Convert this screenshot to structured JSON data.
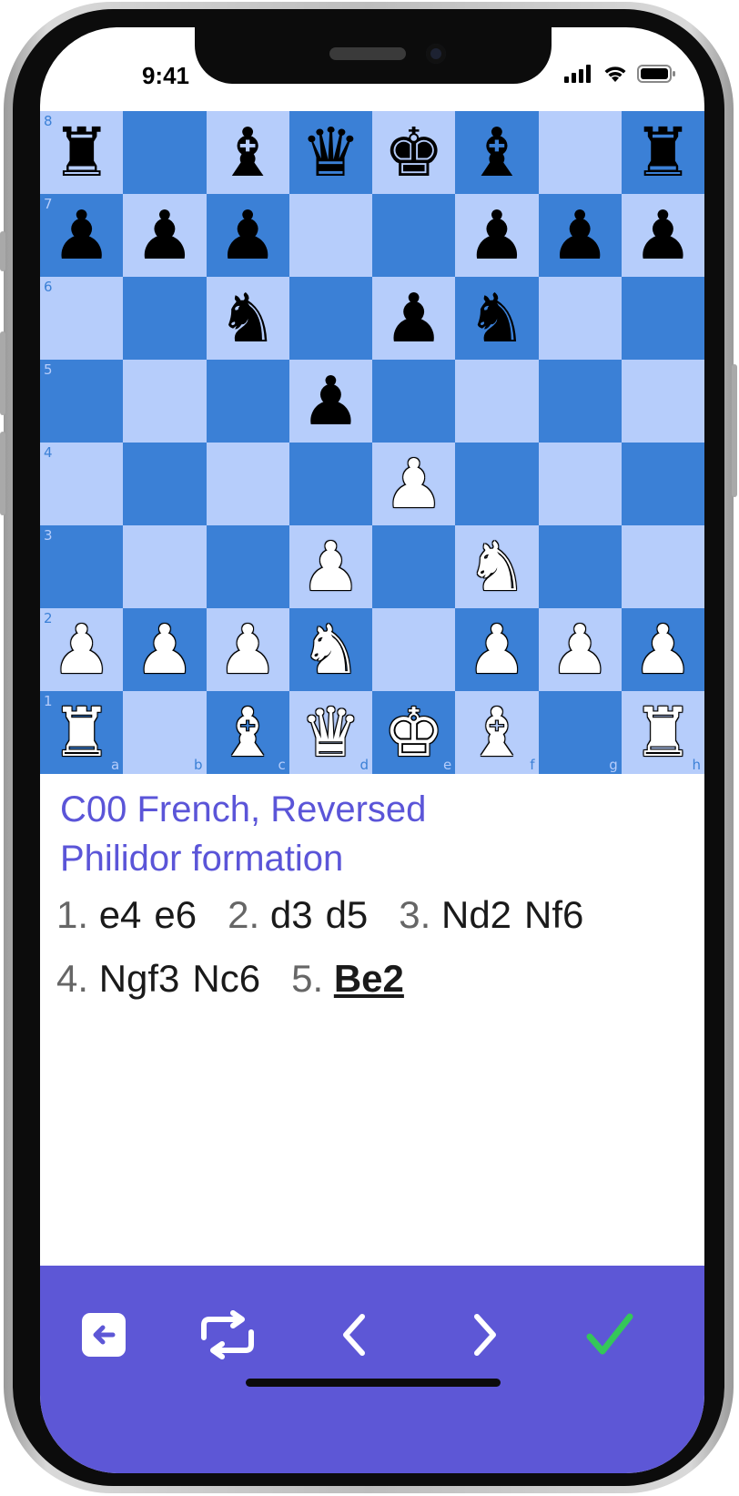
{
  "status": {
    "time": "9:41"
  },
  "board": {
    "rows": [
      [
        "br",
        "",
        "bb",
        "bq",
        "bk",
        "bb",
        "",
        "br"
      ],
      [
        "bp",
        "bp",
        "bp",
        "",
        "",
        "bp",
        "bp",
        "bp"
      ],
      [
        "",
        "",
        "bn",
        "",
        "bp",
        "bn",
        "",
        ""
      ],
      [
        "",
        "",
        "",
        "bp",
        "",
        "",
        "",
        ""
      ],
      [
        "",
        "",
        "",
        "",
        "wp",
        "",
        "",
        ""
      ],
      [
        "",
        "",
        "",
        "wp",
        "",
        "wn",
        "",
        ""
      ],
      [
        "wp",
        "wp",
        "wp",
        "wn",
        "",
        "wp",
        "wp",
        "wp"
      ],
      [
        "wr",
        "",
        "wb",
        "wq",
        "wk",
        "wb",
        "",
        "wr"
      ]
    ],
    "ranks": [
      "8",
      "7",
      "6",
      "5",
      "4",
      "3",
      "2",
      "1"
    ],
    "files": [
      "a",
      "b",
      "c",
      "d",
      "e",
      "f",
      "g",
      "h"
    ],
    "colors": {
      "light": "#b6cdfb",
      "dark": "#3b80d6"
    }
  },
  "opening": {
    "line1": "C00 French, Reversed",
    "line2": "Philidor formation",
    "color": "#5b55d8"
  },
  "moves": [
    {
      "num": "1.",
      "white": "e4",
      "black": "e6"
    },
    {
      "num": "2.",
      "white": "d3",
      "black": "d5"
    },
    {
      "num": "3.",
      "white": "Nd2",
      "black": "Nf6"
    },
    {
      "num": "4.",
      "white": "Ngf3",
      "black": "Nc6"
    },
    {
      "num": "5.",
      "white": "Be2",
      "black": ""
    }
  ],
  "current_move": "Be2",
  "toolbar": {
    "color": "#5d57d6",
    "buttons": [
      {
        "icon": "back-to-list-icon"
      },
      {
        "icon": "flip-board-icon"
      },
      {
        "icon": "previous-move-icon"
      },
      {
        "icon": "next-move-icon"
      },
      {
        "icon": "checkmark-icon"
      }
    ],
    "check_color": "#34c759"
  }
}
